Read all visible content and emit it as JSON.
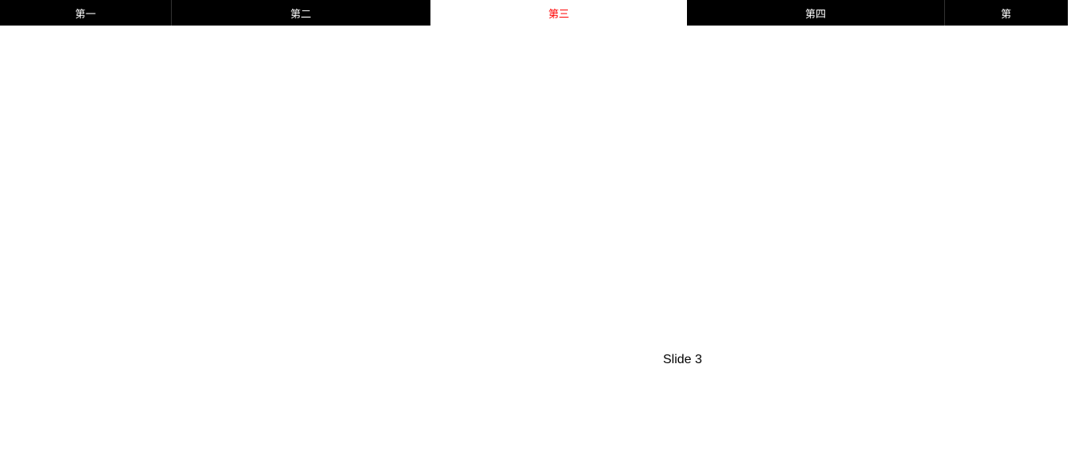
{
  "tabs": [
    {
      "label": "第一",
      "active": false
    },
    {
      "label": "第二",
      "active": false
    },
    {
      "label": "第三",
      "active": true
    },
    {
      "label": "第四",
      "active": false
    },
    {
      "label": "第",
      "active": false
    }
  ],
  "content": {
    "slide_label": "Slide 3"
  }
}
